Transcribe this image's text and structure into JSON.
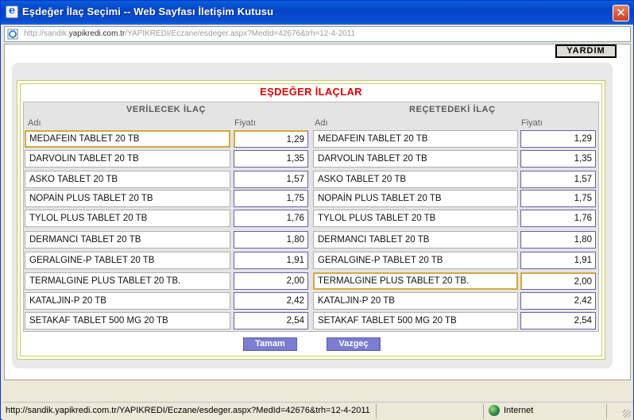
{
  "window": {
    "title": "Eşdeğer İlaç Seçimi -- Web Sayfası İletişim Kutusu",
    "close_label": "✕"
  },
  "address": {
    "prefix": "http://sandik.",
    "host": "yapikredi.com.tr",
    "suffix": "/YAPIKREDI/Eczane/esdeger.aspx?MedId=42676&trh=12-4-2011"
  },
  "toolbar": {
    "help_label": "YARDIM"
  },
  "main": {
    "heading": "EŞDEĞER İLAÇLAR",
    "left": {
      "title": "VERİLECEK İLAÇ",
      "name_header": "Adı",
      "price_header": "Fiyatı",
      "rows": [
        {
          "name": "MEDAFEIN TABLET 20 TB",
          "price": "1,29"
        },
        {
          "name": "DARVOLIN TABLET 20 TB",
          "price": "1,35"
        },
        {
          "name": "ASKO TABLET 20 TB",
          "price": "1,57"
        },
        {
          "name": "NOPAİN PLUS TABLET 20 TB",
          "price": "1,75"
        },
        {
          "name": "TYLOL PLUS TABLET 20 TB",
          "price": "1,76"
        },
        {
          "name": "DERMANCI TABLET 20 TB",
          "price": "1,80"
        },
        {
          "name": "GERALGINE-P TABLET 20 TB",
          "price": "1,91"
        },
        {
          "name": "TERMALGINE PLUS TABLET 20 TB.",
          "price": "2,00"
        },
        {
          "name": "KATALJIN-P 20 TB",
          "price": "2,42"
        },
        {
          "name": "SETAKAF TABLET 500 MG 20 TB",
          "price": "2,54"
        }
      ]
    },
    "right": {
      "title": "REÇETEDEKİ İLAÇ",
      "name_header": "Adı",
      "price_header": "Fiyatı",
      "rows": [
        {
          "name": "MEDAFEIN TABLET 20 TB",
          "price": "1,29"
        },
        {
          "name": "DARVOLIN TABLET 20 TB",
          "price": "1,35"
        },
        {
          "name": "ASKO TABLET 20 TB",
          "price": "1,57"
        },
        {
          "name": "NOPAİN PLUS TABLET 20 TB",
          "price": "1,75"
        },
        {
          "name": "TYLOL PLUS TABLET 20 TB",
          "price": "1,76"
        },
        {
          "name": "DERMANCI TABLET 20 TB",
          "price": "1,80"
        },
        {
          "name": "GERALGINE-P TABLET 20 TB",
          "price": "1,91"
        },
        {
          "name": "TERMALGINE PLUS TABLET 20 TB.",
          "price": "2,00"
        },
        {
          "name": "KATALJIN-P 20 TB",
          "price": "2,42"
        },
        {
          "name": "SETAKAF TABLET 500 MG 20 TB",
          "price": "2,54"
        }
      ]
    },
    "ok_label": "Tamam",
    "cancel_label": "Vazgeç"
  },
  "status": {
    "url": "http://sandik.yapikredi.com.tr/YAPIKREDI/Eczane/esdeger.aspx?MedId=42676&trh=12-4-2011",
    "zone": "Internet"
  },
  "colors": {
    "heading": "#e00000",
    "button": "#7b7dce",
    "selected_border": "#d3a840",
    "price_border": "#6a60a8",
    "panel_border": "#c9ca60"
  },
  "icons": [
    "ie-page-icon",
    "close-icon",
    "internet-zone-icon",
    "resize-grip-icon"
  ]
}
